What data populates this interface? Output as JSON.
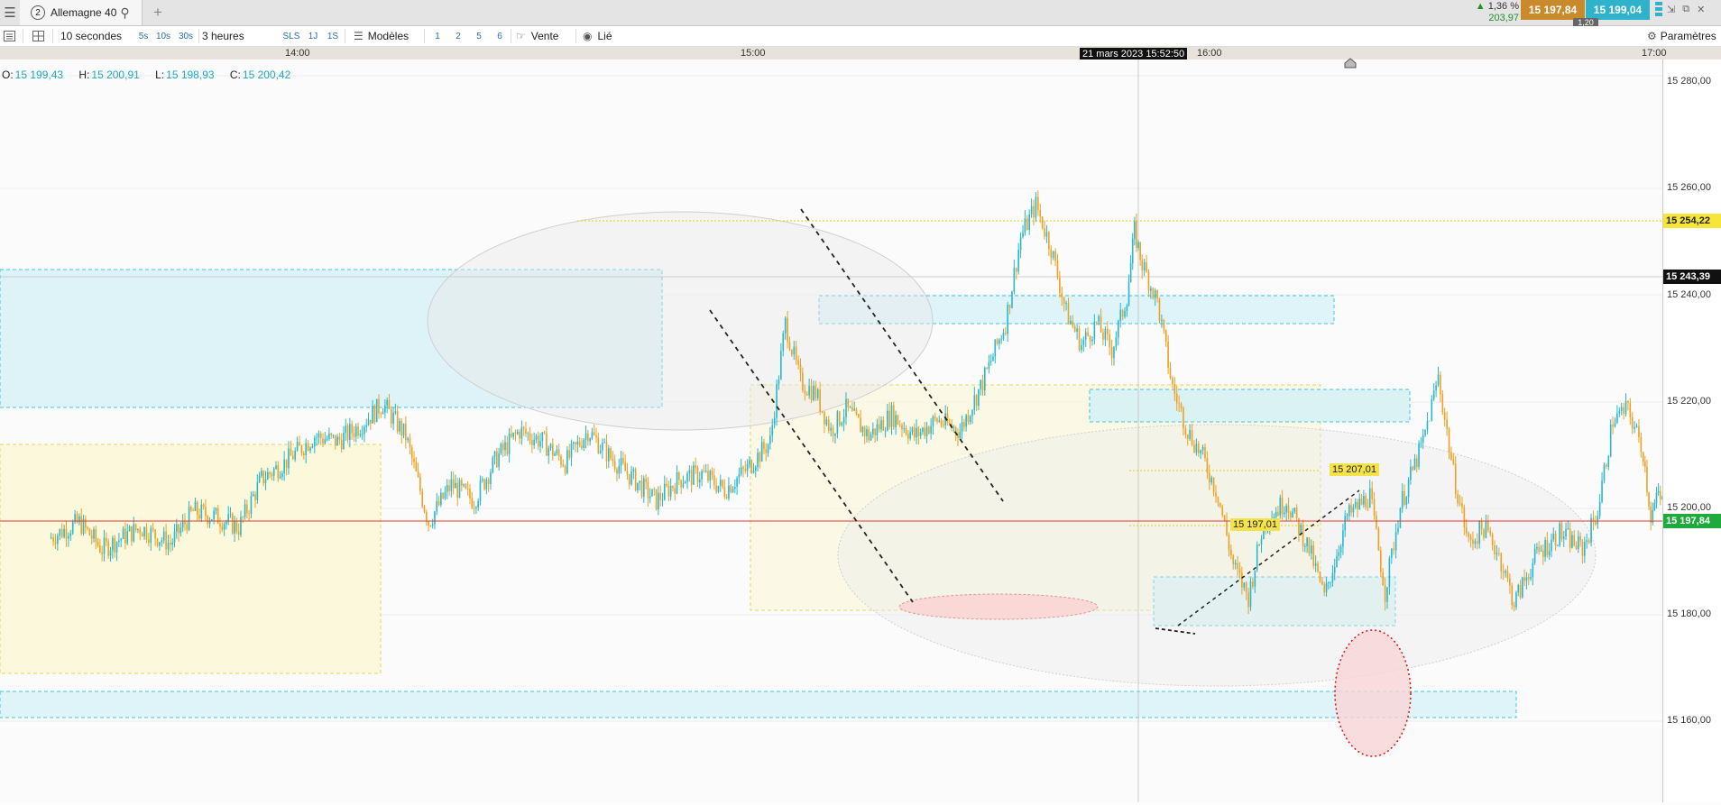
{
  "app": {
    "menu_icon": "hamburger-icon",
    "tab": {
      "number": "2",
      "title": "Allemagne 40",
      "search_icon": "search-icon"
    },
    "add_tab": "+"
  },
  "quote": {
    "change_pct": "1,36 %",
    "change_abs": "203,97",
    "sell": "15 197,84",
    "buy": "15 199,04",
    "spread": "1,20"
  },
  "toolbar": {
    "interval": "10 secondes",
    "q5s": "5s",
    "q10s": "10s",
    "q30s": "30s",
    "period": "3 heures",
    "sls": "SLS",
    "p1j": "1J",
    "p1s": "1S",
    "models": "Modèles",
    "l1": "1",
    "l2": "2",
    "l5": "5",
    "l6": "6",
    "sell_label": "Vente",
    "linked": "Lié",
    "settings": "Paramètres"
  },
  "time_axis": {
    "t1": "14:00",
    "t2": "15:00",
    "cursor": "21 mars 2023 15:52:50",
    "t3": "16:00",
    "t4": "17:00"
  },
  "ohlc": {
    "o_label": "O:",
    "o": "15 199,43",
    "h_label": "H:",
    "h": "15 200,91",
    "l_label": "L:",
    "l": "15 198,93",
    "c_label": "C:",
    "c": "15 200,42"
  },
  "price_axis": {
    "p280": "15 280,00",
    "p260": "15 260,00",
    "p240": "15 240,00",
    "p220": "15 220,00",
    "p200": "15 200,00",
    "p180": "15 180,00",
    "p160": "15 160,00",
    "tag_resistance": "15 254,22",
    "tag_crosshair": "15 243,39",
    "tag_current": "15 197,84"
  },
  "chart_labels": {
    "level_a": "15 207,01",
    "level_b": "15 197,01"
  },
  "chart_data": {
    "type": "candlestick",
    "instrument": "Allemagne 40",
    "interval": "10 secondes",
    "period": "3 heures",
    "x_ticks": [
      "14:00",
      "15:00",
      "16:00",
      "17:00"
    ],
    "y_ticks": [
      15160,
      15180,
      15200,
      15220,
      15240,
      15260,
      15280
    ],
    "ylim": [
      15148,
      15290
    ],
    "current_price": 15197.84,
    "horizontal_levels": [
      15254.22,
      15207.01,
      15197.01
    ],
    "price_path": [
      [
        "13:27",
        15194
      ],
      [
        "13:31",
        15197
      ],
      [
        "13:34",
        15192
      ],
      [
        "13:39",
        15196
      ],
      [
        "13:43",
        15193
      ],
      [
        "13:46",
        15199
      ],
      [
        "13:49",
        15198
      ],
      [
        "13:52",
        15196
      ],
      [
        "13:55",
        15205
      ],
      [
        "13:58",
        15208
      ],
      [
        "14:02",
        15213
      ],
      [
        "14:05",
        15212
      ],
      [
        "14:08",
        15215
      ],
      [
        "14:11",
        15219
      ],
      [
        "14:14",
        15213
      ],
      [
        "14:17",
        15197
      ],
      [
        "14:20",
        15204
      ],
      [
        "14:23",
        15201
      ],
      [
        "14:26",
        15209
      ],
      [
        "14:29",
        15214
      ],
      [
        "14:32",
        15212
      ],
      [
        "14:35",
        15208
      ],
      [
        "14:38",
        15214
      ],
      [
        "14:41",
        15209
      ],
      [
        "14:44",
        15205
      ],
      [
        "14:47",
        15201
      ],
      [
        "14:50",
        15205
      ],
      [
        "14:53",
        15206
      ],
      [
        "14:56",
        15203
      ],
      [
        "14:59",
        15207
      ],
      [
        "15:02",
        15212
      ],
      [
        "15:04",
        15234
      ],
      [
        "15:06",
        15223
      ],
      [
        "15:08",
        15221
      ],
      [
        "15:10",
        15214
      ],
      [
        "15:12",
        15218
      ],
      [
        "15:15",
        15213
      ],
      [
        "15:18",
        15217
      ],
      [
        "15:21",
        15213
      ],
      [
        "15:24",
        15216
      ],
      [
        "15:27",
        15214
      ],
      [
        "15:30",
        15223
      ],
      [
        "15:33",
        15234
      ],
      [
        "15:35",
        15250
      ],
      [
        "15:37",
        15256
      ],
      [
        "15:39",
        15248
      ],
      [
        "15:41",
        15236
      ],
      [
        "15:43",
        15230
      ],
      [
        "15:45",
        15234
      ],
      [
        "15:47",
        15229
      ],
      [
        "15:49",
        15239
      ],
      [
        "15:50",
        15251
      ],
      [
        "15:51",
        15245
      ],
      [
        "15:53",
        15238
      ],
      [
        "15:55",
        15222
      ],
      [
        "15:57",
        15214
      ],
      [
        "15:59",
        15209
      ],
      [
        "16:01",
        15202
      ],
      [
        "16:03",
        15189
      ],
      [
        "16:05",
        15183
      ],
      [
        "16:07",
        15197
      ],
      [
        "16:10",
        15201
      ],
      [
        "16:13",
        15192
      ],
      [
        "16:15",
        15183
      ],
      [
        "16:18",
        15198
      ],
      [
        "16:21",
        15202
      ],
      [
        "16:23",
        15184
      ],
      [
        "16:25",
        15200
      ],
      [
        "16:28",
        15212
      ],
      [
        "16:30",
        15224
      ],
      [
        "16:32",
        15206
      ],
      [
        "16:34",
        15193
      ],
      [
        "16:36",
        15196
      ],
      [
        "16:38",
        15191
      ],
      [
        "16:40",
        15182
      ],
      [
        "16:43",
        15191
      ],
      [
        "16:46",
        15195
      ],
      [
        "16:49",
        15192
      ],
      [
        "16:51",
        15199
      ],
      [
        "16:53",
        15216
      ],
      [
        "16:55",
        15218
      ],
      [
        "16:57",
        15210
      ],
      [
        "16:58",
        15198
      ],
      [
        "16:59",
        15202
      ],
      [
        "17:00",
        15199
      ]
    ]
  },
  "colors": {
    "up_candle": "#26b8d0",
    "down_candle": "#f0a020",
    "current_line": "#e53935",
    "resistance_line": "#e8d000",
    "zone_cyan": "#d9f1f6",
    "zone_yellow": "#fbf8dc"
  }
}
